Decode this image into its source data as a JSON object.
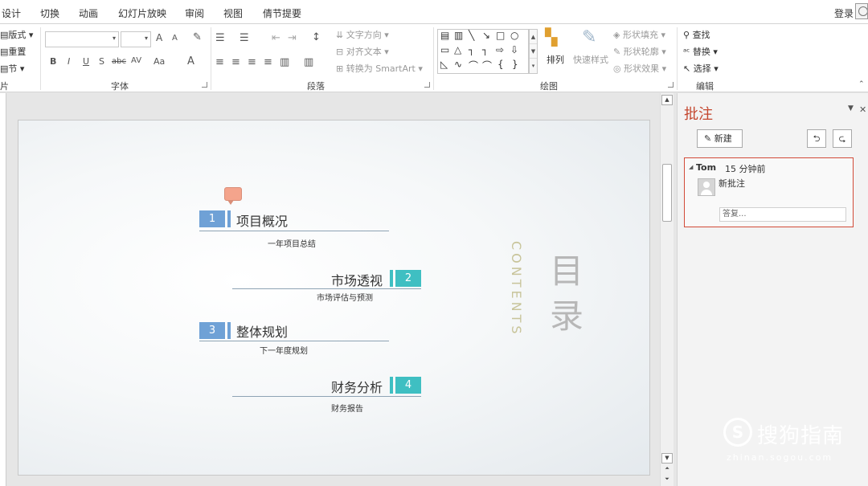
{
  "menu": {
    "tabs": [
      "设计",
      "切换",
      "动画",
      "幻灯片放映",
      "审阅",
      "视图",
      "倩节提要"
    ],
    "login": "登录"
  },
  "ribbon": {
    "slides": {
      "layout": "版式",
      "reset": "重置",
      "section": "节",
      "group": "片"
    },
    "font": {
      "group": "字体",
      "bold": "B",
      "italic": "I",
      "underline": "U",
      "shadow": "S",
      "strike": "abc",
      "spacing": "AV",
      "case": "Aa",
      "color": "A",
      "grow": "A",
      "shrink": "A"
    },
    "paragraph": {
      "group": "段落",
      "text_direction": "文字方向",
      "align_text": "对齐文本",
      "convert_smartart": "转换为 SmartArt"
    },
    "drawing": {
      "group": "绘图",
      "arrange": "排列",
      "quick_styles": "快速样式",
      "shape_fill": "形状填充",
      "shape_outline": "形状轮廓",
      "shape_effects": "形状效果"
    },
    "editing": {
      "group": "编辑",
      "find": "查找",
      "replace": "替换",
      "select": "选择"
    }
  },
  "slide": {
    "items": [
      {
        "num": "1",
        "title": "项目概况",
        "subtitle": "一年项目总结"
      },
      {
        "num": "2",
        "title": "市场透视",
        "subtitle": "市场评估与预测"
      },
      {
        "num": "3",
        "title": "整体规划",
        "subtitle": "下一年度规划"
      },
      {
        "num": "4",
        "title": "财务分析",
        "subtitle": "财务报告"
      }
    ],
    "contents_en": "CONTENTS",
    "contents_cn_1": "目",
    "contents_cn_2": "录",
    "colors": {
      "blue": "#6fa1d6",
      "teal": "#3fbfc2",
      "gold": "#c8c49a"
    }
  },
  "comments_pane": {
    "title": "批注",
    "new_button": "新建",
    "comment": {
      "author": "Tom",
      "time": "15 分钟前",
      "text": "新批注",
      "reply_placeholder": "答复..."
    }
  },
  "watermark": {
    "brand": "搜狗指南",
    "url": "zhinan.sogou.com"
  }
}
